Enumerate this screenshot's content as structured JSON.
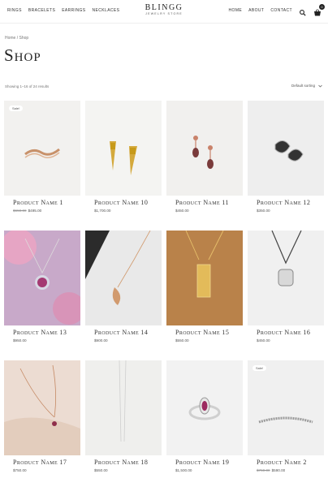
{
  "header": {
    "nav_left": [
      "Rings",
      "Bracelets",
      "Earrings",
      "Necklaces"
    ],
    "logo_name": "BLINGG",
    "logo_sub": "JEWELRY STORE",
    "nav_right": [
      "Home",
      "About",
      "Contact"
    ],
    "cart_count": "0"
  },
  "breadcrumb": "Home / Shop",
  "title": "Shop",
  "result_count": "Showing 1–16 of 24 results",
  "sort_label": "Default sorting",
  "products": [
    {
      "name": "Product Name 1",
      "old_price": "$650.00",
      "price": "$495.00",
      "sale": "Sale!"
    },
    {
      "name": "Product Name 10",
      "price": "$1,700.00"
    },
    {
      "name": "Product Name 11",
      "price": "$450.00"
    },
    {
      "name": "Product Name 12",
      "price": "$350.00"
    },
    {
      "name": "Product Name 13",
      "price": "$950.00"
    },
    {
      "name": "Product Name 14",
      "price": "$900.00"
    },
    {
      "name": "Product Name 15",
      "price": "$550.00"
    },
    {
      "name": "Product Name 16",
      "price": "$450.00"
    },
    {
      "name": "Product Name 17",
      "price": "$750.00"
    },
    {
      "name": "Product Name 18",
      "price": "$550.00"
    },
    {
      "name": "Product Name 19",
      "price": "$1,500.00"
    },
    {
      "name": "Product Name 2",
      "old_price": "$750.00",
      "price": "$590.00",
      "sale": "Sale!"
    }
  ],
  "icons": {
    "search": "search-icon",
    "cart": "cart-icon",
    "sort": "chevron-down-icon"
  },
  "colors": {
    "text": "#222222",
    "muted": "#777777",
    "badge": "#222222"
  }
}
